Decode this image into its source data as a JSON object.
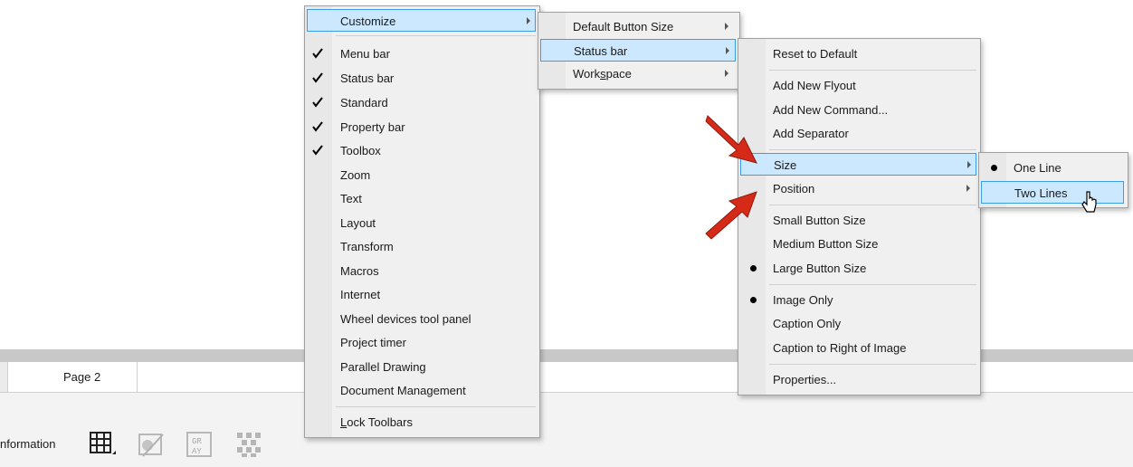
{
  "background": {
    "page_tab": "Page 2",
    "status_label": "nformation",
    "status_icons": [
      "grid-icon",
      "color-proof-icon",
      "grayscale-icon",
      "pattern-icon"
    ]
  },
  "menu_main": {
    "customize": "Customize",
    "items": [
      {
        "label": "Menu bar",
        "checked": true
      },
      {
        "label": "Status bar",
        "checked": true
      },
      {
        "label": "Standard",
        "checked": true
      },
      {
        "label": "Property bar",
        "checked": true
      },
      {
        "label": "Toolbox",
        "checked": true
      },
      {
        "label": "Zoom",
        "checked": false
      },
      {
        "label": "Text",
        "checked": false
      },
      {
        "label": "Layout",
        "checked": false
      },
      {
        "label": "Transform",
        "checked": false
      },
      {
        "label": "Macros",
        "checked": false
      },
      {
        "label": "Internet",
        "checked": false
      },
      {
        "label": "Wheel devices tool panel",
        "checked": false
      },
      {
        "label": "Project timer",
        "checked": false
      },
      {
        "label": "Parallel Drawing",
        "checked": false
      },
      {
        "label": "Document Management",
        "checked": false
      }
    ],
    "lock_toolbars": "Lock Toolbars"
  },
  "menu_customize": {
    "default_button_size": "Default Button Size",
    "status_bar": "Status bar",
    "workspace_pre": "Work",
    "workspace_u": "s",
    "workspace_post": "pace"
  },
  "menu_statusbar": {
    "reset": "Reset to Default",
    "add_flyout": "Add New Flyout",
    "add_command": "Add New Command...",
    "add_separator": "Add Separator",
    "size": "Size",
    "position": "Position",
    "small": "Small Button Size",
    "medium": "Medium Button Size",
    "large": "Large Button Size",
    "image_only": "Image Only",
    "caption_only": "Caption Only",
    "caption_right": "Caption to Right of Image",
    "properties": "Properties..."
  },
  "menu_size": {
    "one_line": "One Line",
    "two_lines": "Two Lines"
  },
  "colors": {
    "highlight_bg": "#cce8ff",
    "highlight_border": "#3c9ce6",
    "annotation_arrow": "#d62a18"
  }
}
